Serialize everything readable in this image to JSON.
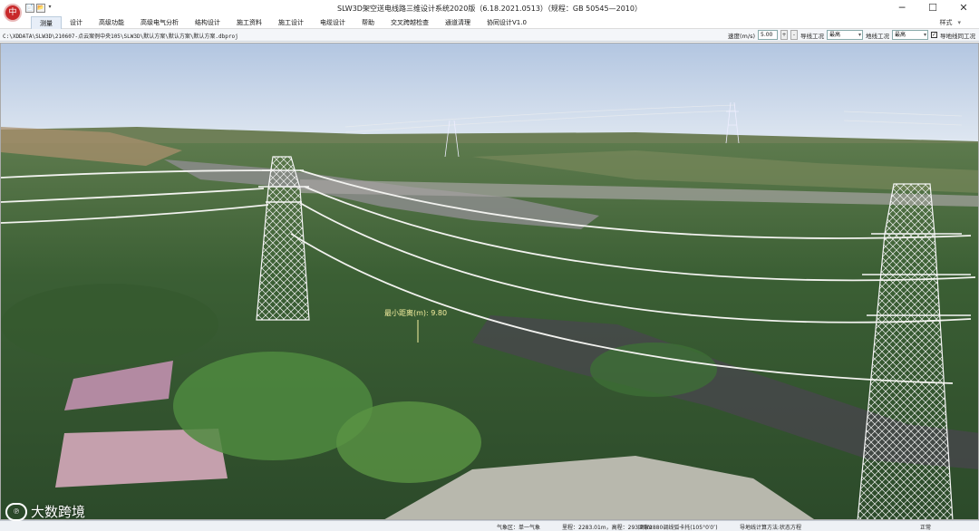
{
  "app": {
    "title": "SLW3D架空送电线路三维设计系统2020版（6.18.2021.0513）（规程：GB 50545—2010）",
    "logo": "中"
  },
  "quick_access": [
    "📄",
    "📂",
    "▾"
  ],
  "window_controls": [
    "─",
    "☐",
    "✕"
  ],
  "menu": {
    "items": [
      "测量",
      "设计",
      "高级功能",
      "高级电气分析",
      "结构设计",
      "施工资料",
      "施工设计",
      "电缆设计",
      "帮助",
      "交叉跨越检查",
      "通道清理",
      "协同设计V1.0"
    ],
    "active_index": 0,
    "style_label": "样式",
    "style_arrow": "▾"
  },
  "toolbar": {
    "path": "C:\\XDDATA\\SLW3D\\210607-点云案例中央105\\SLW3D\\默认方案\\默认方案\\默认方案.dbproj",
    "speed_label": "速度(m/s)",
    "speed_value": "5.00",
    "spin_up": "+",
    "spin_down": "-",
    "conductor_label": "导线工况",
    "conductor_value": "最高",
    "ground_label": "地线工况",
    "ground_value": "最高",
    "checkbox_label": "导地线同工况",
    "checkbox_checked": "✓"
  },
  "viewport": {
    "annotation": "最小距离(m): 9.80"
  },
  "status": {
    "weather": "气象区：单一气象",
    "coords": "里程：2283.01m，高程：293.29m",
    "tower": "国家2880调线弧卡托(105°0′0″)",
    "method": "导地线计算方法:状态方程",
    "state": "正常"
  },
  "watermark": {
    "icon": "℗",
    "text": "大数跨境"
  },
  "colors": {
    "sky_top": "#b7c9e2",
    "vegetation": "#3f6b3a",
    "conductor": "#f2f2ef",
    "annotation": "#f6f0a0"
  }
}
